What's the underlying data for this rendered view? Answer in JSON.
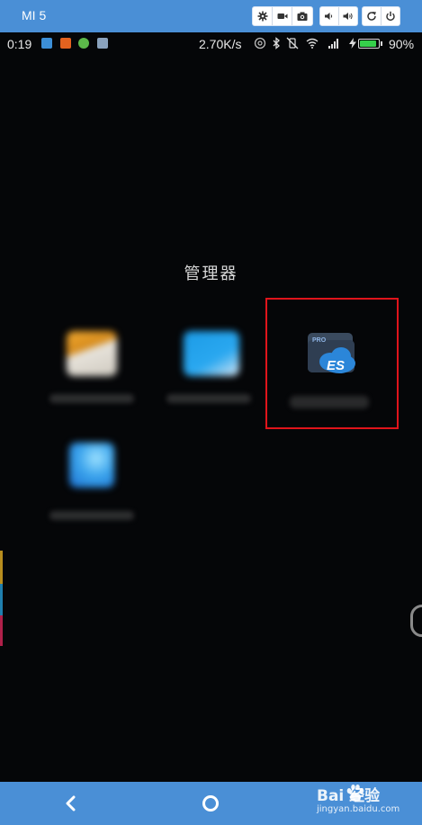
{
  "emulator": {
    "device_name": "MI 5",
    "controls": [
      "settings-icon",
      "video-icon",
      "camera-icon",
      "volume-down-icon",
      "volume-up-icon",
      "rotate-icon",
      "power-icon"
    ]
  },
  "status_bar": {
    "time": "0:19",
    "network_speed": "2.70K/s",
    "battery_percent": "90%",
    "battery_level": 0.9,
    "battery_color": "#36d04a"
  },
  "folder": {
    "title": "管理器",
    "apps": [
      {
        "name": "blurred-app-1",
        "icon": "folder-icon"
      },
      {
        "name": "blurred-app-2",
        "icon": "file-manager-icon"
      },
      {
        "name": "es-file-explorer-pro",
        "icon": "es-pro-icon",
        "badge": "PRO",
        "mark": "ES"
      },
      {
        "name": "blurred-app-4",
        "icon": "gallery-icon"
      }
    ],
    "highlight_color": "#e0141b"
  },
  "navigation": {
    "back": "back-icon",
    "home": "home-icon"
  },
  "watermark": {
    "main": "Bai 经验",
    "sub": "jingyan.baidu.com"
  },
  "colors": {
    "accent": "#4a8fd6",
    "background": "#050608"
  }
}
